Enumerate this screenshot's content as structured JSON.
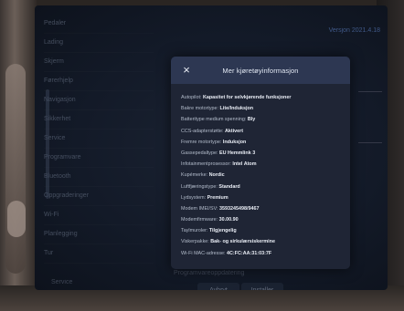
{
  "background": {
    "menu_items": [
      "Pedaler",
      "Lading",
      "Skjerm",
      "Førerhjelp",
      "Navigasjon",
      "Sikkerhet",
      "Service",
      "Programvare",
      "Bluetooth",
      "Oppgraderinger",
      "Wi-Fi",
      "Planlegging",
      "Tur"
    ],
    "top_right_text": "Versjon 2021.4.18",
    "footer_text": "Programvareoppdatering",
    "footer_btn_left": "Avbryt",
    "footer_btn_right": "Installer",
    "bottom_left_text": "Service"
  },
  "modal": {
    "title": "Mer kjøretøyinformasjon",
    "close_icon": "×",
    "rows": [
      {
        "key": "Autopilot:",
        "value": "Kapasitet for selvkjørende funksjoner"
      },
      {
        "key": "Bakre motortype:",
        "value": "Lite/Induksjon"
      },
      {
        "key": "Batteritype medium spenning:",
        "value": "Bly"
      },
      {
        "key": "CCS-adapterstøtte:",
        "value": "Aktivert"
      },
      {
        "key": "Fremre motortype:",
        "value": "Induksjon"
      },
      {
        "key": "Gassepedaltype:",
        "value": "EU Hemmlink 3"
      },
      {
        "key": "Infotainmentprosessor:",
        "value": "Intel Atom"
      },
      {
        "key": "Kupémerke:",
        "value": "Nordic"
      },
      {
        "key": "Luftfjæringstype:",
        "value": "Standard"
      },
      {
        "key": "Lydsystem:",
        "value": "Premium"
      },
      {
        "key": "Modem IMEI/SV:",
        "value": "3593245498/9467"
      },
      {
        "key": "Modemfirmware:",
        "value": "30.00.90"
      },
      {
        "key": "Taylmuroler:",
        "value": "Tilgjengelig"
      },
      {
        "key": "Viskerpakke:",
        "value": "Bak- og sirkulærsiskermine"
      },
      {
        "key": "Wi-Fi MAC-adresse:",
        "value": "4C:FC:AA:31:03:7F"
      }
    ]
  }
}
